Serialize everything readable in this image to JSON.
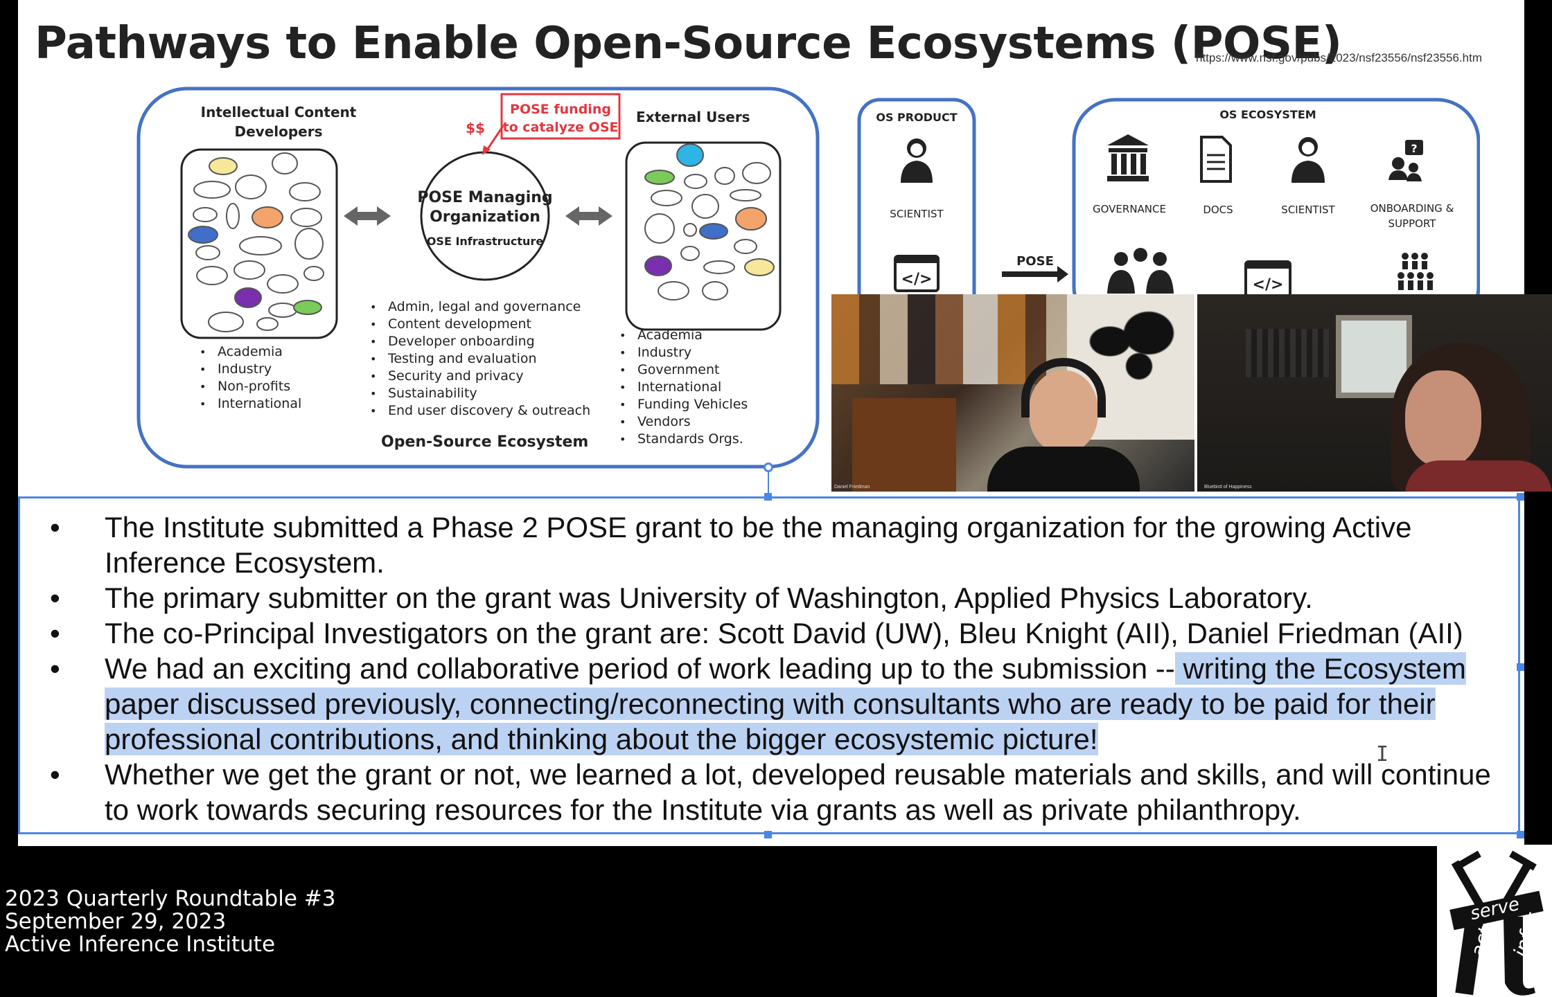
{
  "slide": {
    "title": "Pathways to Enable Open-Source Ecosystems (POSE)",
    "url": "https://www.nsf.gov/pubs/2023/nsf23556/nsf23556.htm",
    "diagram": {
      "left_group_title": "Intellectual Content Developers",
      "left_list": [
        "Academia",
        "Industry",
        "Non-profits",
        "International"
      ],
      "funding_callout_line1": "POSE funding",
      "funding_callout_line2": "to catalyze OSE",
      "funding_symbol": "$$",
      "center_title_line1": "POSE Managing",
      "center_title_line2": "Organization",
      "center_subtitle": "OSE Infrastructure",
      "center_list": [
        "Admin, legal and governance",
        "Content development",
        "Developer onboarding",
        "Testing and evaluation",
        "Security and privacy",
        "Sustainability",
        "End user discovery & outreach"
      ],
      "ecosystem_label": "Open-Source Ecosystem",
      "right_group_title": "External Users",
      "right_list": [
        "Academia",
        "Industry",
        "Government",
        "International",
        "Funding Vehicles",
        "Vendors",
        "Standards Orgs."
      ]
    },
    "os_product": {
      "title": "OS PRODUCT",
      "scientist_label": "SCIENTIST"
    },
    "pose_arrow_label": "POSE",
    "os_ecosystem": {
      "title": "OS ECOSYSTEM",
      "items": [
        "GOVERNANCE",
        "DOCS",
        "SCIENTIST",
        "ONBOARDING &",
        "SUPPORT"
      ]
    },
    "bullets": [
      "The Institute submitted a Phase 2 POSE grant to be the managing organization for the growing Active Inference Ecosystem.",
      "The primary submitter on the grant was University of Washington, Applied Physics Laboratory.",
      "The co-Principal Investigators on the grant are: Scott David (UW), Bleu Knight (AII), Daniel Friedman (AII)"
    ],
    "bullet4_plain": "We had an exciting and collaborative period of work leading up to the submission --",
    "bullet4_highlight": " writing the Ecosystem paper discussed previously, connecting/reconnecting with consultants who are ready to be paid for their professional contributions, and thinking about the bigger ecosystemic picture!",
    "bullet5": "Whether we get the grant or not, we learned a lot, developed reusable materials and skills, and will continue to work towards securing resources for the Institute via grants as well as private philanthropy."
  },
  "webcams": [
    {
      "name": "Daniel Friedman"
    },
    {
      "name": "Bluebird of Happiness"
    }
  ],
  "caption": {
    "line1": "2023 Quarterly Roundtable #3",
    "line2": "September 29, 2023",
    "line3": "Active Inference Institute"
  },
  "logo": {
    "word1": "serve",
    "word2": "act",
    "word3": "infer"
  },
  "colors": {
    "diagram_blue": "#4472c4",
    "highlight": "#bcd2f3",
    "callout_red": "#e0383e",
    "selection_blue": "#4a86e8"
  }
}
